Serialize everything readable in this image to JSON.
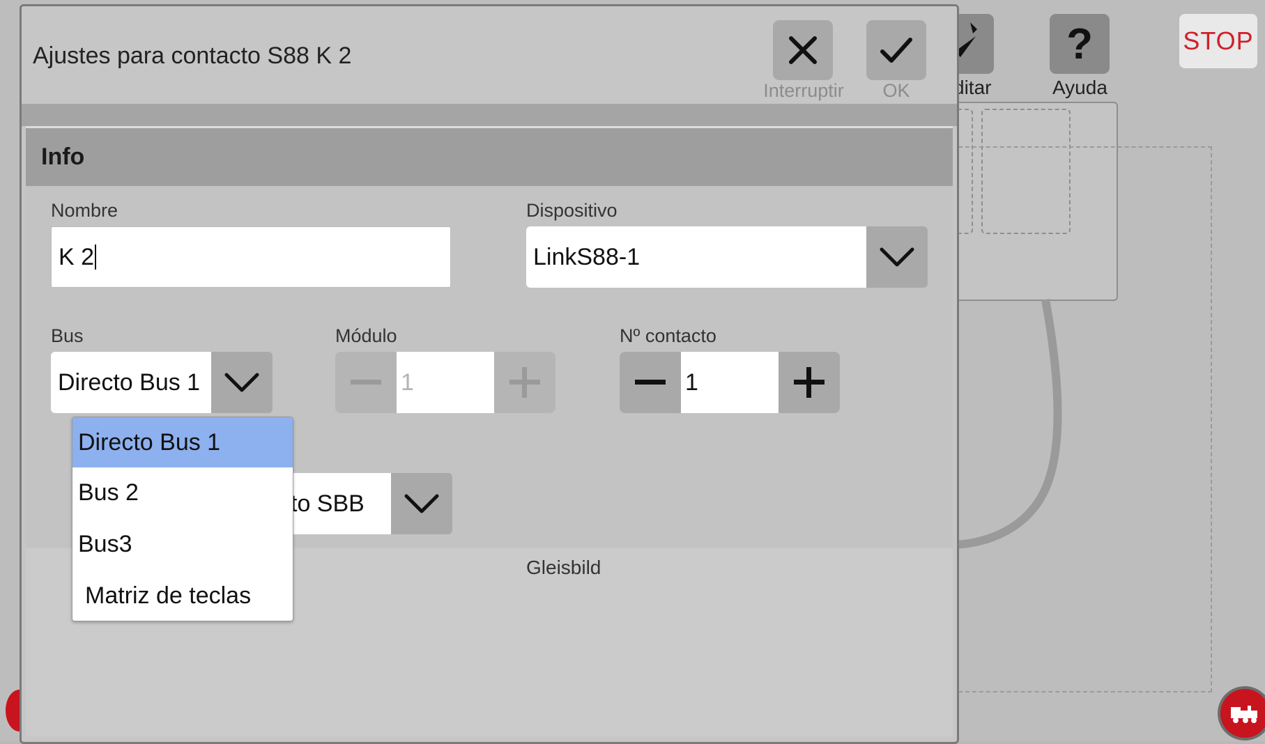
{
  "background": {
    "toolbar": {
      "edit_label": "ditar",
      "help_label": "Ayuda",
      "help_glyph": "?",
      "stop_label": "STOP"
    }
  },
  "dialog": {
    "title": "Ajustes para contacto S88 K 2",
    "cancel_label": "Interruptir",
    "ok_label": "OK",
    "section_title": "Info",
    "name": {
      "label": "Nombre",
      "value": "K 2"
    },
    "device": {
      "label": "Dispositivo",
      "value": "LinkS88-1"
    },
    "bus": {
      "label": "Bus",
      "value": "Directo Bus 1"
    },
    "module": {
      "label": "Módulo",
      "value": "1",
      "enabled": false
    },
    "contact": {
      "label": "Nº contacto",
      "value": "1"
    },
    "hidden_select_partial": "to SBB",
    "lower_label": "Gleisbild",
    "bus_dropdown": {
      "options": [
        "Directo Bus 1",
        "Bus 2",
        "Bus3",
        "Matriz de teclas"
      ],
      "selected_index": 0
    }
  },
  "colors": {
    "accent_selected": "#8db0ef",
    "stop_red": "#d0202a",
    "loco_red": "#c8141e"
  }
}
